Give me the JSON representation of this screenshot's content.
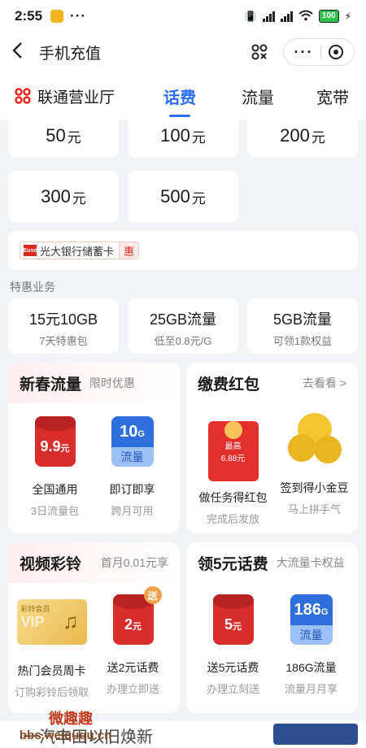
{
  "status_bar": {
    "time": "2:55",
    "more": "···",
    "battery": "100"
  },
  "nav": {
    "back_icon": "chevron-left",
    "title": "手机充值",
    "scan_icon": "scan",
    "more": "···"
  },
  "tabs": {
    "brand": "联通营业厅",
    "items": [
      "话费",
      "流量",
      "宽带"
    ],
    "active": "话费"
  },
  "amounts": [
    {
      "value": "50",
      "unit": "元"
    },
    {
      "value": "100",
      "unit": "元"
    },
    {
      "value": "200",
      "unit": "元"
    },
    {
      "value": "300",
      "unit": "元"
    },
    {
      "value": "500",
      "unit": "元"
    }
  ],
  "promo": {
    "bank_label": "光大银行储蓄卡",
    "badge": "惠",
    "icon_text": "Euse"
  },
  "special": {
    "label": "特惠业务",
    "packages": [
      {
        "name": "15元10GB",
        "desc": "7天特惠包"
      },
      {
        "name": "25GB流量",
        "desc": "低至0.8元/G"
      },
      {
        "name": "5GB流量",
        "desc": "可领1款权益"
      }
    ]
  },
  "cards": {
    "spring": {
      "title": "新春流量",
      "subtitle": "限时优惠",
      "items": [
        {
          "pack": "9.9",
          "pack_unit": "元",
          "label": "全国通用",
          "sub": "3日流量包"
        },
        {
          "pack": "10",
          "pack_unit": "G",
          "pack_bottom": "流量",
          "label": "即订即享",
          "sub": "跨月可用"
        }
      ]
    },
    "redpacket": {
      "title": "缴费红包",
      "link": "去看看 >",
      "items": [
        {
          "pack_top": "最高",
          "pack": "6.88元",
          "label": "做任务得红包",
          "sub": "完成后发放"
        },
        {
          "label": "签到得小金豆",
          "sub": "马上拼手气"
        }
      ]
    },
    "ringtone": {
      "title": "视频彩铃",
      "subtitle": "首月0.01元享",
      "items": [
        {
          "pack": "彩铃会员",
          "pack_big": "VIP",
          "label": "热门会员周卡",
          "sub": "订购彩铃后领取"
        },
        {
          "badge": "送",
          "pack": "2",
          "pack_unit": "元",
          "label": "送2元话费",
          "sub": "办理立即送"
        }
      ]
    },
    "bonus": {
      "title": "领5元话费",
      "subtitle": "大流量卡权益",
      "items": [
        {
          "pack": "5",
          "pack_unit": "元",
          "label": "送5元话费",
          "sub": "办理立刻送"
        },
        {
          "pack": "186",
          "pack_unit": "G",
          "pack_bottom": "流量",
          "label": "186G流量",
          "sub": "流量月月享"
        }
      ]
    }
  },
  "watermark": {
    "line1": "微趣趣",
    "line2": "bbs.weiququ.cn"
  },
  "footer": {
    "banner_text": "一汽丰田以旧焕新"
  }
}
